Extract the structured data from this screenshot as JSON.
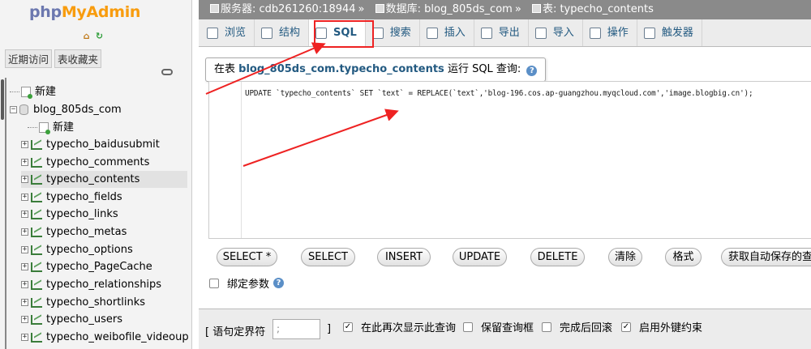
{
  "logo": {
    "part1": "php",
    "part2": "MyAdmin"
  },
  "nav": {
    "home_icon": "home-icon",
    "reload_icon": "reload-icon",
    "recent_label": "近期访问",
    "favorites_label": "表收藏夹",
    "new_label": "新建",
    "db_name": "blog_805ds_com",
    "db_new_label": "新建",
    "tables": [
      "typecho_baidusubmit",
      "typecho_comments",
      "typecho_contents",
      "typecho_fields",
      "typecho_links",
      "typecho_metas",
      "typecho_options",
      "typecho_PageCache",
      "typecho_relationships",
      "typecho_shortlinks",
      "typecho_users",
      "typecho_weibofile_videoup"
    ],
    "active_table": "typecho_contents"
  },
  "breadcrumb": {
    "server": "服务器: cdb261260:18944",
    "database": "数据库: blog_805ds_com",
    "table": "表: typecho_contents"
  },
  "tabs": [
    "浏览",
    "结构",
    "SQL",
    "搜索",
    "插入",
    "导出",
    "导入",
    "操作",
    "触发器"
  ],
  "active_tab": "SQL",
  "query": {
    "legend_prefix": "在表",
    "legend_table": "blog_805ds_com.typecho_contents",
    "legend_suffix": "运行 SQL 查询:",
    "sql_text": "UPDATE `typecho_contents` SET `text` = REPLACE(`text`,'blog-196.cos.ap-guangzhou.myqcloud.com','image.blogbig.cn');"
  },
  "buttons": [
    "SELECT *",
    "SELECT",
    "INSERT",
    "UPDATE",
    "DELETE",
    "清除",
    "格式",
    "获取自动保存的查询"
  ],
  "bind_params_label": "绑定参数",
  "bottom": {
    "delimiter_label": "[ 语句定界符",
    "delimiter_value": ";",
    "delimiter_close": "]",
    "options": [
      {
        "label": "在此再次显示此查询",
        "checked": true
      },
      {
        "label": "保留查询框",
        "checked": false
      },
      {
        "label": "完成后回滚",
        "checked": false
      },
      {
        "label": "启用外键约束",
        "checked": true
      }
    ]
  },
  "colors": {
    "accent_red": "#e22222",
    "link_blue": "#235a81",
    "logo_orange": "#f89c0e",
    "logo_blue": "#6c78af"
  }
}
